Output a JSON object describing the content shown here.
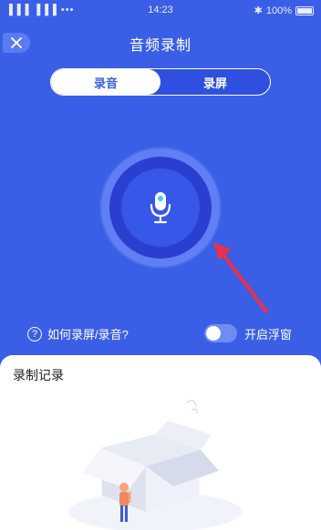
{
  "status_bar": {
    "signal_text": "▐▐▐ ▐▐▐ •••",
    "time": "14:23",
    "bluetooth": "✱",
    "battery_text": "100%"
  },
  "header": {
    "title": "音频录制"
  },
  "tabs": [
    {
      "label": "录音",
      "active": true
    },
    {
      "label": "录屏",
      "active": false
    }
  ],
  "mic": {
    "icon": "microphone-icon",
    "accent": "#3fd0ff"
  },
  "help": {
    "icon_glyph": "?",
    "label": "如何录屏/录音?"
  },
  "float_window": {
    "label": "开启浮窗",
    "enabled": false
  },
  "records": {
    "title": "录制记录"
  },
  "colors": {
    "background": "#3a5fe6",
    "arrow": "#e8314a"
  }
}
